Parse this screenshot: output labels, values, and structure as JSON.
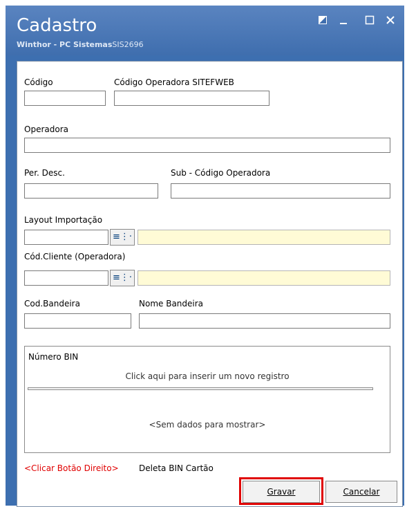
{
  "window": {
    "title": "Cadastro",
    "subtitle": "Winthor - PC Sistemas",
    "subtitle_code": "SIS2696"
  },
  "form": {
    "codigo_label": "Código",
    "codigo_value": "",
    "codigo_sitef_label": "Código  Operadora SITEFWEB",
    "codigo_sitef_value": "",
    "operadora_label": "Operadora",
    "operadora_value": "",
    "per_desc_label": "Per. Desc.",
    "per_desc_value": "",
    "sub_codigo_label": "Sub - Código Operadora",
    "sub_codigo_value": "",
    "layout_label": "Layout Importação",
    "layout_value": "",
    "layout_desc": "",
    "cod_cliente_label": "Cód.Cliente (Operadora)",
    "cod_cliente_value": "",
    "cod_cliente_desc": "",
    "cod_bandeira_label": "Cod.Bandeira",
    "cod_bandeira_value": "",
    "nome_bandeira_label": "Nome Bandeira",
    "nome_bandeira_value": ""
  },
  "grid": {
    "title": "Número BIN",
    "new_row_text": "Click aqui para inserir um novo registro",
    "empty_text": "<Sem dados para mostrar>"
  },
  "hint": {
    "red": "<Clicar Botão Direito>",
    "black": "Deleta BIN Cartão"
  },
  "buttons": {
    "gravar": "Gravar",
    "cancelar": "Cancelar"
  },
  "colors": {
    "titlebar": "#3f6eae",
    "highlight": "#e00000",
    "readonly_field": "#fffbd6"
  }
}
